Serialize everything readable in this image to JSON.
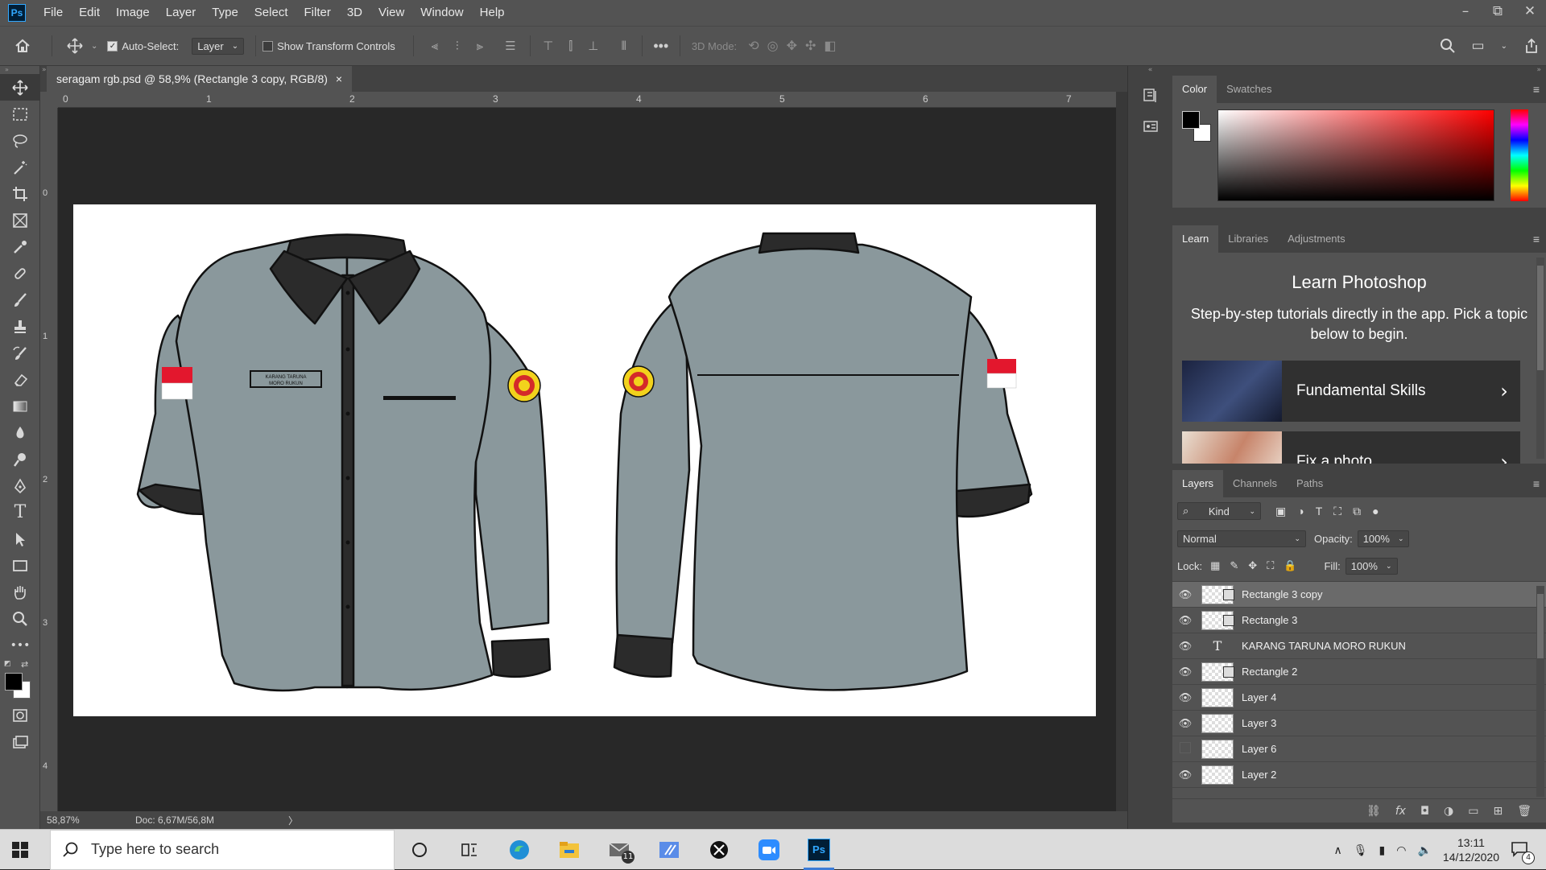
{
  "app": {
    "logo": "Ps",
    "brand_color": "#31a8ff"
  },
  "menu": [
    "File",
    "Edit",
    "Image",
    "Layer",
    "Type",
    "Select",
    "Filter",
    "3D",
    "View",
    "Window",
    "Help"
  ],
  "window_controls": {
    "minimize": "–",
    "restore": "⧉",
    "close": "✕"
  },
  "options_bar": {
    "auto_select_label": "Auto-Select:",
    "auto_select_checked": true,
    "auto_select_target": "Layer",
    "show_transform_label": "Show Transform Controls",
    "show_transform_checked": false,
    "mode_3d_label": "3D Mode:"
  },
  "document": {
    "tab_title": "seragam rgb.psd @ 58,9% (Rectangle 3 copy, RGB/8)",
    "tab_close": "×",
    "ruler_h": [
      "0",
      "1",
      "2",
      "3",
      "4",
      "5",
      "6",
      "7"
    ],
    "ruler_v": [
      "0",
      "1",
      "2",
      "3",
      "4"
    ]
  },
  "status": {
    "zoom": "58,87%",
    "doc": "Doc: 6,67M/56,8M",
    "arrow": "〉"
  },
  "artwork": {
    "shirt_color": "#8a989c",
    "collar_color": "#2b2b2b",
    "badge_text_1": "KARANG TARUNA",
    "badge_text_2": "MORO RUKUN",
    "flag_red": "#e3172d"
  },
  "color_panel": {
    "tabs": [
      "Color",
      "Swatches"
    ],
    "active_tab": "Color",
    "foreground": "#000000",
    "background": "#ffffff",
    "hue": "#ff0000"
  },
  "learn_panel": {
    "tabs": [
      "Learn",
      "Libraries",
      "Adjustments"
    ],
    "active_tab": "Learn",
    "title": "Learn Photoshop",
    "description": "Step-by-step tutorials directly in the app. Pick a topic below to begin.",
    "cards": [
      {
        "label": "Fundamental Skills",
        "arrow": "›"
      },
      {
        "label": "Fix a photo",
        "arrow": "›"
      }
    ]
  },
  "layers_panel": {
    "tabs": [
      "Layers",
      "Channels",
      "Paths"
    ],
    "active_tab": "Layers",
    "filter_kind": "Kind",
    "blend_mode": "Normal",
    "opacity_label": "Opacity:",
    "opacity": "100%",
    "lock_label": "Lock:",
    "fill_label": "Fill:",
    "fill": "100%",
    "layers": [
      {
        "name": "Rectangle 3 copy",
        "kind": "shape",
        "visible": true,
        "selected": true
      },
      {
        "name": "Rectangle 3",
        "kind": "shape",
        "visible": true,
        "selected": false
      },
      {
        "name": "KARANG TARUNA  MORO RUKUN",
        "kind": "text",
        "visible": true,
        "selected": false
      },
      {
        "name": "Rectangle 2",
        "kind": "shape",
        "visible": true,
        "selected": false
      },
      {
        "name": "Layer 4",
        "kind": "pixel",
        "visible": true,
        "selected": false
      },
      {
        "name": "Layer 3",
        "kind": "pixel",
        "visible": true,
        "selected": false
      },
      {
        "name": "Layer 6",
        "kind": "pixel",
        "visible": false,
        "selected": false
      },
      {
        "name": "Layer 2",
        "kind": "pixel",
        "visible": true,
        "selected": false
      }
    ]
  },
  "taskbar": {
    "search_placeholder": "Type here to search",
    "mail_badge": "11",
    "time": "13:11",
    "date": "14/12/2020",
    "notification_count": "4"
  }
}
